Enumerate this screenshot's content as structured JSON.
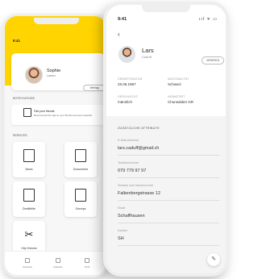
{
  "back_phone": {
    "status_time": "9:41",
    "profile": {
      "name": "Sophie",
      "role": "Larsen",
      "button_label": "Vertrag"
    },
    "notifications": {
      "section_title": "NOTIFICATIONS",
      "item_title": "Fall your friends",
      "item_text": "Recommend the app to your friends and earn rewards"
    },
    "services": {
      "section_title": "SERVICES",
      "tiles": [
        {
          "label": "News",
          "icon": "news-icon"
        },
        {
          "label": "Documents",
          "icon": "document-icon"
        },
        {
          "label": "Deaflirtlite",
          "icon": "form-icon"
        },
        {
          "label": "Surveys",
          "icon": "survey-icon"
        },
        {
          "label": "City Director",
          "icon": "tools-icon"
        }
      ]
    },
    "nav": [
      {
        "label": "Overview"
      },
      {
        "label": "Kalender"
      },
      {
        "label": "Profil"
      }
    ]
  },
  "front_phone": {
    "status_time": "9:41",
    "status_icons": "ııl ᯤ ▭",
    "back_icon": "‹",
    "profile": {
      "name": "Lars",
      "subtitle": "Caduff",
      "badge": "VERIFIED"
    },
    "details": [
      {
        "label": "GEBURTSDATUM",
        "value": "25.06.1987"
      },
      {
        "label": "NATIONALITÄT",
        "value": "Schweiz"
      },
      {
        "label": "GESCHLECHT",
        "value": "männlich"
      },
      {
        "label": "HEIMATORT",
        "value": "Churwalden GR"
      }
    ],
    "attributes": {
      "section_title": "ZUSÄTZLICHE ATTRIBUTE",
      "fields": [
        {
          "label": "E-Mail-Adresse",
          "value": "lars.caduff@gmail.ch"
        },
        {
          "label": "Telefonnummer",
          "value": "079 779 97 97"
        },
        {
          "label": "Strasse und Hausnummer",
          "value": "Falkenbergstrasse 12"
        },
        {
          "label": "Stadt",
          "value": "Schaffhausen"
        },
        {
          "label": "Kanton",
          "value": "SH"
        }
      ]
    },
    "fab_icon": "✎"
  },
  "colors": {
    "accent": "#ffd400",
    "background": "#ffffff"
  }
}
